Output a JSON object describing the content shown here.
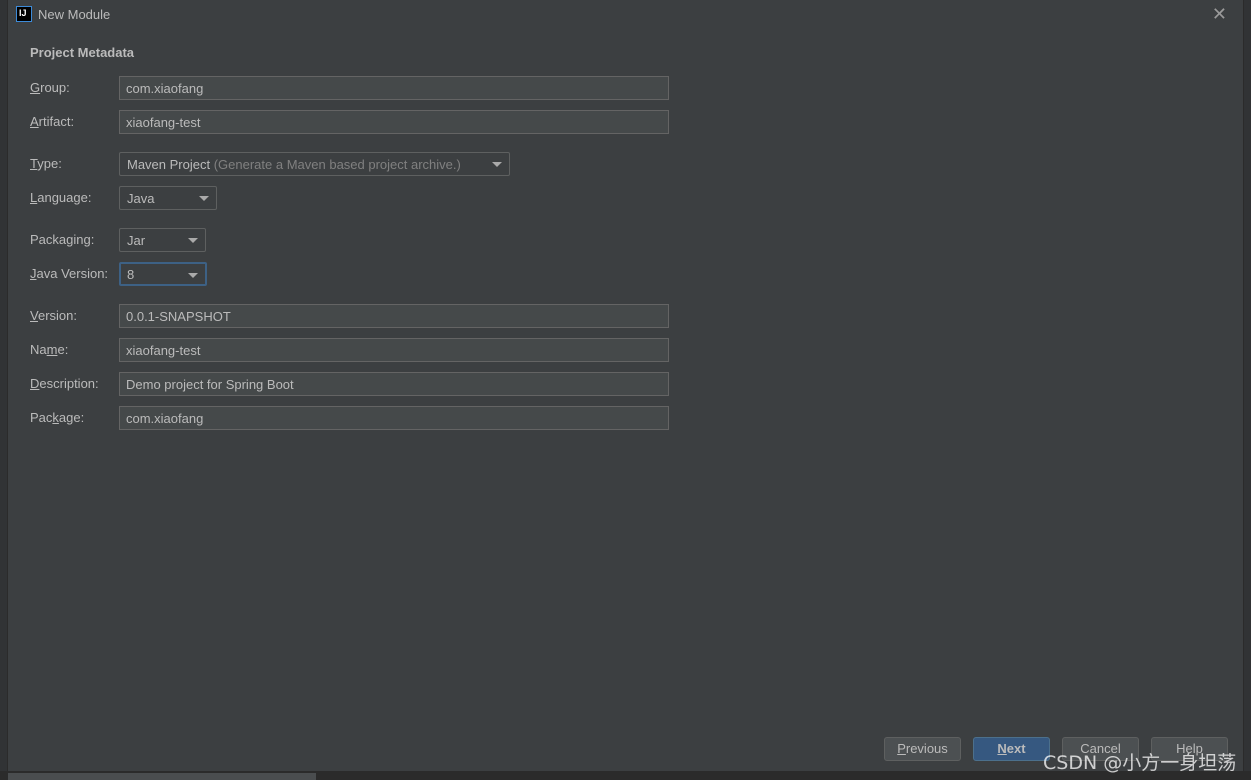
{
  "window": {
    "title": "New Module",
    "logo": "IJ"
  },
  "section_title": "Project Metadata",
  "fields": {
    "group": {
      "label_u": "G",
      "label_rest": "roup:",
      "value": "com.xiaofang"
    },
    "artifact": {
      "label_u": "A",
      "label_rest": "rtifact:",
      "value": "xiaofang-test"
    },
    "version": {
      "label_u": "V",
      "label_rest": "ersion:",
      "value": "0.0.1-SNAPSHOT"
    },
    "name": {
      "label_pre": "Na",
      "label_u": "m",
      "label_rest": "e:",
      "value": "xiaofang-test"
    },
    "description": {
      "label_u": "D",
      "label_rest": "escription:",
      "value": "Demo project for Spring Boot"
    },
    "package": {
      "label_pre": "Pac",
      "label_u": "k",
      "label_rest": "age:",
      "value": "com.xiaofang"
    }
  },
  "combos": {
    "type": {
      "label_u": "T",
      "label_rest": "ype:",
      "value": "Maven Project",
      "hint": "(Generate a Maven based project archive.)"
    },
    "language": {
      "label_pre": "",
      "label_u": "L",
      "label_rest": "anguage:",
      "value": "Java"
    },
    "packaging": {
      "label_pre": "Packa",
      "label_u": "g",
      "label_rest": "ing:",
      "value": "Jar"
    },
    "java_version": {
      "label_u": "J",
      "label_rest": "ava Version:",
      "value": "8"
    }
  },
  "buttons": {
    "previous": {
      "u": "P",
      "rest": "revious"
    },
    "next": {
      "u": "N",
      "rest": "ext"
    },
    "cancel": "Cancel",
    "help": "Help"
  },
  "watermark": "CSDN @小方一身坦荡",
  "colors": {
    "background": "#3c3f41",
    "field": "#45494a",
    "primary": "#365880",
    "focus": "#3d6185"
  }
}
